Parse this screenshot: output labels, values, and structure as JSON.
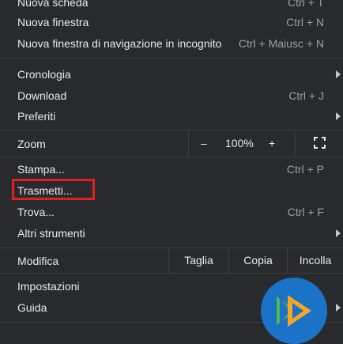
{
  "menu": {
    "new_tab": {
      "label": "Nuova scheda",
      "shortcut": "Ctrl + T"
    },
    "new_window": {
      "label": "Nuova finestra",
      "shortcut": "Ctrl + N"
    },
    "incognito": {
      "label": "Nuova finestra di navigazione in incognito",
      "shortcut": "Ctrl + Maiusc + N"
    },
    "history": {
      "label": "Cronologia"
    },
    "downloads": {
      "label": "Download",
      "shortcut": "Ctrl + J"
    },
    "bookmarks": {
      "label": "Preferiti"
    },
    "zoom": {
      "label": "Zoom",
      "minus": "–",
      "value": "100%",
      "plus": "+"
    },
    "print": {
      "label": "Stampa...",
      "shortcut": "Ctrl + P"
    },
    "cast": {
      "label": "Trasmetti..."
    },
    "find": {
      "label": "Trova...",
      "shortcut": "Ctrl + F"
    },
    "more_tools": {
      "label": "Altri strumenti"
    },
    "edit": {
      "label": "Modifica",
      "cut": "Taglia",
      "copy": "Copia",
      "paste": "Incolla"
    },
    "settings": {
      "label": "Impostazioni"
    },
    "help": {
      "label": "Guida"
    }
  },
  "colors": {
    "background": "#292a2d",
    "text": "#e8eaed",
    "shortcut_text": "#9aa0a6",
    "separator": "#3c3d40",
    "highlight": "#e0201b",
    "logo_blue": "#1a73c6",
    "logo_orange": "#f5a623",
    "logo_green": "#55b84b"
  },
  "icons": {
    "fullscreen": "fullscreen-icon",
    "submenu": "chevron-right-icon",
    "logo": "watermark-logo"
  }
}
